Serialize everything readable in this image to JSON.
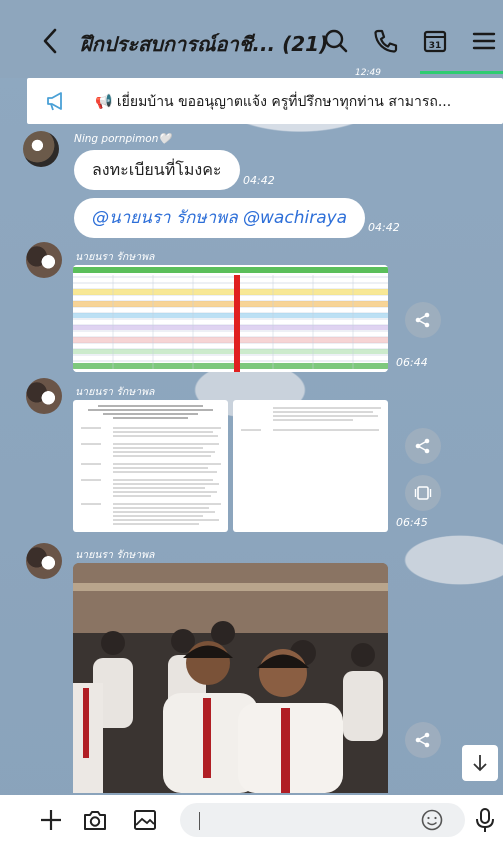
{
  "header": {
    "back_icon": "chevron-left-icon",
    "title": "ฝึกประสบการณ์อาชี... (21)",
    "icons": [
      "search-icon",
      "phone-icon",
      "calendar-icon",
      "menu-icon"
    ],
    "calendar_day": "31",
    "time_hint": "12:49"
  },
  "announcement": {
    "icon": "megaphone-icon",
    "text": "📢 เยี่ยมบ้าน ขออนุญาตแจ้ง ครูที่ปรึกษาทุกท่าน สามารถ...",
    "chevron": "chevron-down-icon"
  },
  "messages": [
    {
      "sender": "Ning pornpimon🤍",
      "text": "ลงทะเบียนที่โมงคะ",
      "time": "04:42"
    },
    {
      "text": "@นายนรา รักษาพล @wachiraya",
      "time": "04:42"
    },
    {
      "sender": "นายนรา รักษาพล",
      "type": "image",
      "time": "06:44"
    },
    {
      "sender": "นายนรา รักษาพล",
      "type": "document",
      "time": "06:45"
    },
    {
      "sender": "นายนรา รักษาพล",
      "type": "photo"
    }
  ],
  "input": {
    "icons": [
      "plus-icon",
      "camera-icon",
      "image-icon",
      "emoji-icon",
      "mic-icon"
    ],
    "placeholder": ""
  },
  "colors": {
    "chat_bg": "#8ea6bd",
    "mention": "#2e6fd8",
    "accent_green": "#2ecc71"
  }
}
